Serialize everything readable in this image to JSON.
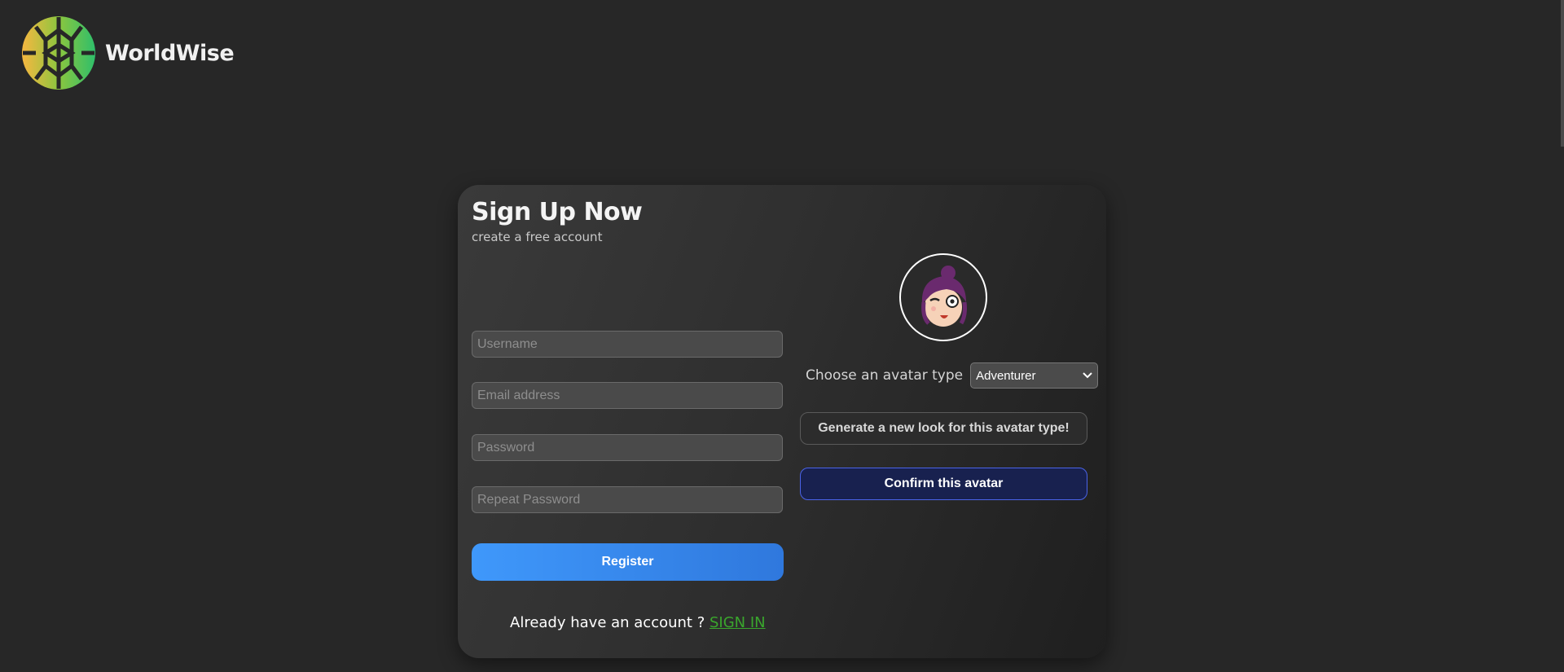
{
  "app": {
    "brand_name": "WorldWise",
    "logo_icon": "geometric-globe-logo"
  },
  "signup": {
    "title": "Sign Up Now",
    "subtitle": "create a free account",
    "fields": {
      "username_placeholder": "Username",
      "email_placeholder": "Email address",
      "password_placeholder": "Password",
      "repeat_password_placeholder": "Repeat Password"
    },
    "register_label": "Register",
    "signin_prompt": "Already have an account ? ",
    "signin_link": "SIGN IN"
  },
  "avatar": {
    "preview_icon": "cartoon-avatar-winking",
    "type_label": "Choose an avatar type",
    "selected_type": "Adventurer",
    "generate_label": "Generate a new look for this avatar type!",
    "confirm_label": "Confirm this avatar"
  },
  "colors": {
    "background": "#272727",
    "register_button": "#3f98fb",
    "confirm_border": "#4a63e8",
    "signin_link": "#3aa62d"
  }
}
